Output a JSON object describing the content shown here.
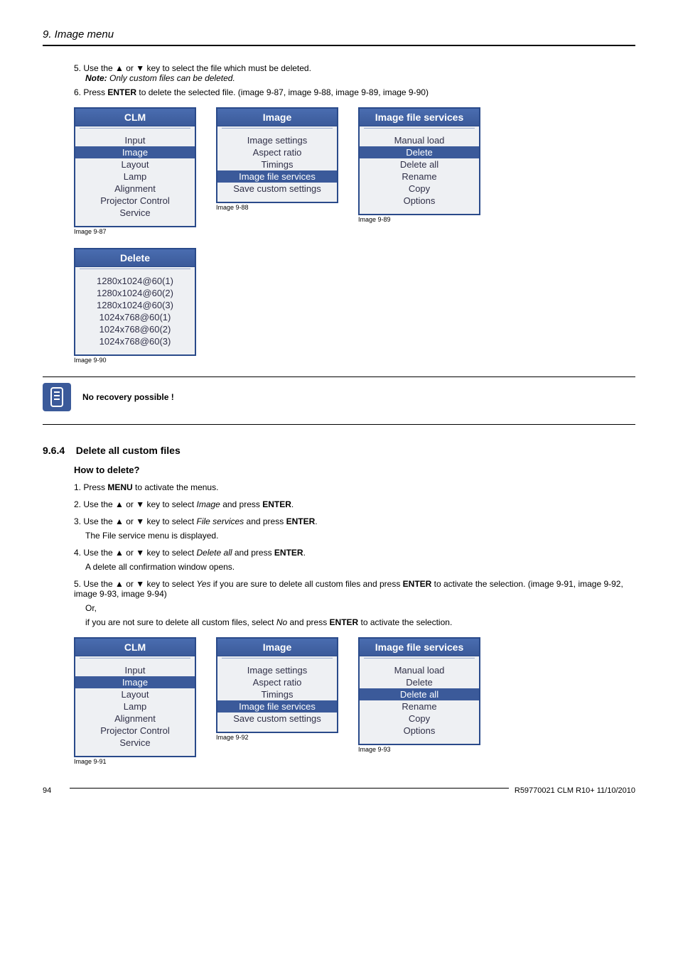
{
  "header": {
    "title": "9. Image menu"
  },
  "steps_top": [
    {
      "n": "5.",
      "text_a": "Use the ▲ or ▼ key to select the file which must be deleted.",
      "note_label": "Note:",
      "note_text": "Only custom files can be deleted."
    },
    {
      "n": "6.",
      "text_a": "Press ",
      "bold1": "ENTER",
      "text_b": " to delete the selected file. (image 9-87, image 9-88, image 9-89, image 9-90)"
    }
  ],
  "menu_clm": {
    "title": "CLM",
    "items": [
      "Input",
      "Image",
      "Layout",
      "Lamp",
      "Alignment",
      "Projector Control",
      "Service"
    ],
    "highlight": "Image",
    "caption": "Image 9-87"
  },
  "menu_image1": {
    "title": "Image",
    "items": [
      "Image settings",
      "Aspect ratio",
      "Timings",
      "Image file services",
      "Save custom settings"
    ],
    "highlight": "Image file services",
    "caption": "Image 9-88"
  },
  "menu_ifs1": {
    "title": "Image file services",
    "items": [
      "Manual load",
      "Delete",
      "Delete all",
      "Rename",
      "Copy",
      "Options"
    ],
    "highlight": "Delete",
    "caption": "Image 9-89"
  },
  "menu_delete": {
    "title": "Delete",
    "items": [
      "1280x1024@60(1)",
      "1280x1024@60(2)",
      "1280x1024@60(3)",
      "1024x768@60(1)",
      "1024x768@60(2)",
      "1024x768@60(3)"
    ],
    "highlight": "",
    "caption": "Image 9-90"
  },
  "tip": {
    "text": "No recovery possible !"
  },
  "section": {
    "num": "9.6.4",
    "title": "Delete all custom files"
  },
  "howto": {
    "title": "How to delete?"
  },
  "steps_bottom": {
    "s1_a": "Press ",
    "s1_b": "MENU",
    "s1_c": " to activate the menus.",
    "s2_a": "Use the ▲ or ▼ key to select ",
    "s2_i": "Image",
    "s2_b": " and press ",
    "s2_bold": "ENTER",
    "s2_c": ".",
    "s3_a": "Use the ▲ or ▼ key to select ",
    "s3_i": "File services",
    "s3_b": " and press ",
    "s3_bold": "ENTER",
    "s3_c": ".",
    "s3_sub": "The File service menu is displayed.",
    "s4_a": "Use the ▲ or ▼ key to select ",
    "s4_i": "Delete all",
    "s4_b": " and press ",
    "s4_bold": "ENTER",
    "s4_c": ".",
    "s4_sub": "A delete all confirmation window opens.",
    "s5_a": "Use the ▲ or ▼ key to select ",
    "s5_i1": "Yes",
    "s5_b": " if you are sure to delete all custom files and press ",
    "s5_bold": "ENTER",
    "s5_c": " to activate the selection. (image 9-91, image 9-92, image 9-93, image 9-94)",
    "s5_or": "Or,",
    "s5_d": "if you are not sure to delete all custom files, select ",
    "s5_i2": "No",
    "s5_e": " and press ",
    "s5_bold2": "ENTER",
    "s5_f": " to activate the selection."
  },
  "menu_clm2": {
    "title": "CLM",
    "items": [
      "Input",
      "Image",
      "Layout",
      "Lamp",
      "Alignment",
      "Projector Control",
      "Service"
    ],
    "highlight": "Image",
    "caption": "Image 9-91"
  },
  "menu_image2": {
    "title": "Image",
    "items": [
      "Image settings",
      "Aspect ratio",
      "Timings",
      "Image file services",
      "Save custom settings"
    ],
    "highlight": "Image file services",
    "caption": "Image 9-92"
  },
  "menu_ifs2": {
    "title": "Image file services",
    "items": [
      "Manual load",
      "Delete",
      "Delete all",
      "Rename",
      "Copy",
      "Options"
    ],
    "highlight": "Delete all",
    "caption": "Image 9-93"
  },
  "footer": {
    "page": "94",
    "doc": "R59770021  CLM R10+  11/10/2010"
  }
}
